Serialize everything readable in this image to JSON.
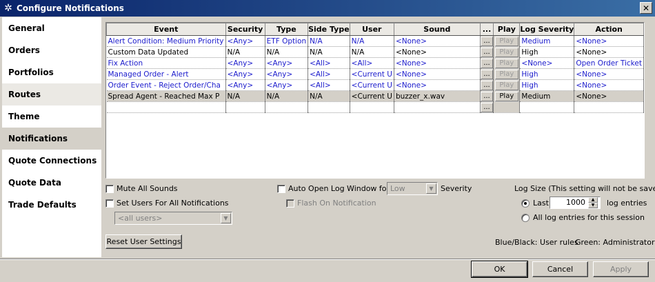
{
  "window": {
    "title": "Configure Notifications",
    "close": "✕"
  },
  "sidebar": {
    "items": [
      {
        "label": "General"
      },
      {
        "label": "Orders"
      },
      {
        "label": "Portfolios"
      },
      {
        "label": "Routes"
      },
      {
        "label": "Theme"
      },
      {
        "label": "Notifications"
      },
      {
        "label": "Quote Connections"
      },
      {
        "label": "Quote Data"
      },
      {
        "label": "Trade Defaults"
      }
    ]
  },
  "grid": {
    "columns": [
      "Event",
      "Security",
      "Type",
      "Side Type",
      "User",
      "Sound",
      "...",
      "Play",
      "Log Severity",
      "Action"
    ],
    "button_dots": "...",
    "button_play": "Play",
    "rows": [
      {
        "event": "Alert Condition: Medium Priority",
        "security": "<Any>",
        "type": "ETF Option",
        "side": "N/A",
        "user": "N/A",
        "sound": "<None>",
        "severity": "Medium",
        "action": "<None>"
      },
      {
        "event": "Custom Data Updated",
        "security": "N/A",
        "type": "N/A",
        "side": "N/A",
        "user": "N/A",
        "sound": "<None>",
        "severity": "High",
        "action": "<None>"
      },
      {
        "event": "Fix Action",
        "security": "<Any>",
        "type": "<Any>",
        "side": "<All>",
        "user": "<All>",
        "sound": "<None>",
        "severity": "<None>",
        "action": "Open Order Ticket"
      },
      {
        "event": "Managed Order - Alert",
        "security": "<Any>",
        "type": "<Any>",
        "side": "<All>",
        "user": "<Current U",
        "sound": "<None>",
        "severity": "High",
        "action": "<None>"
      },
      {
        "event": "Order Event - Reject Order/Cha",
        "security": "<Any>",
        "type": "<Any>",
        "side": "<All>",
        "user": "<Current U",
        "sound": "<None>",
        "severity": "High",
        "action": "<None>"
      },
      {
        "event": "Spread Agent - Reached Max P",
        "security": "N/A",
        "type": "N/A",
        "side": "N/A",
        "user": "<Current U",
        "sound": "buzzer_x.wav",
        "severity": "Medium",
        "action": "<None>"
      },
      {
        "event": "",
        "security": "",
        "type": "",
        "side": "",
        "user": "",
        "sound": "",
        "severity": "",
        "action": ""
      }
    ]
  },
  "options": {
    "mute_all_sounds": "Mute All Sounds",
    "set_users_all": "Set Users For All Notifications",
    "users_combo": "<all users>",
    "auto_open_log": "Auto Open Log Window for:",
    "severity_combo": "Low",
    "severity_label": "Severity",
    "flash_on_notification": "Flash On Notification",
    "reset_user_settings": "Reset User Settings"
  },
  "log": {
    "title": "Log Size (This setting will not be saved)",
    "last_label": "Last",
    "last_value": "1000",
    "log_entries": "log entries",
    "all_entries": "All log entries for this session"
  },
  "legend": {
    "blue_black": "Blue/Black: User rules",
    "green": "Green: Administrator"
  },
  "footer": {
    "ok": "OK",
    "cancel": "Cancel",
    "apply": "Apply"
  }
}
